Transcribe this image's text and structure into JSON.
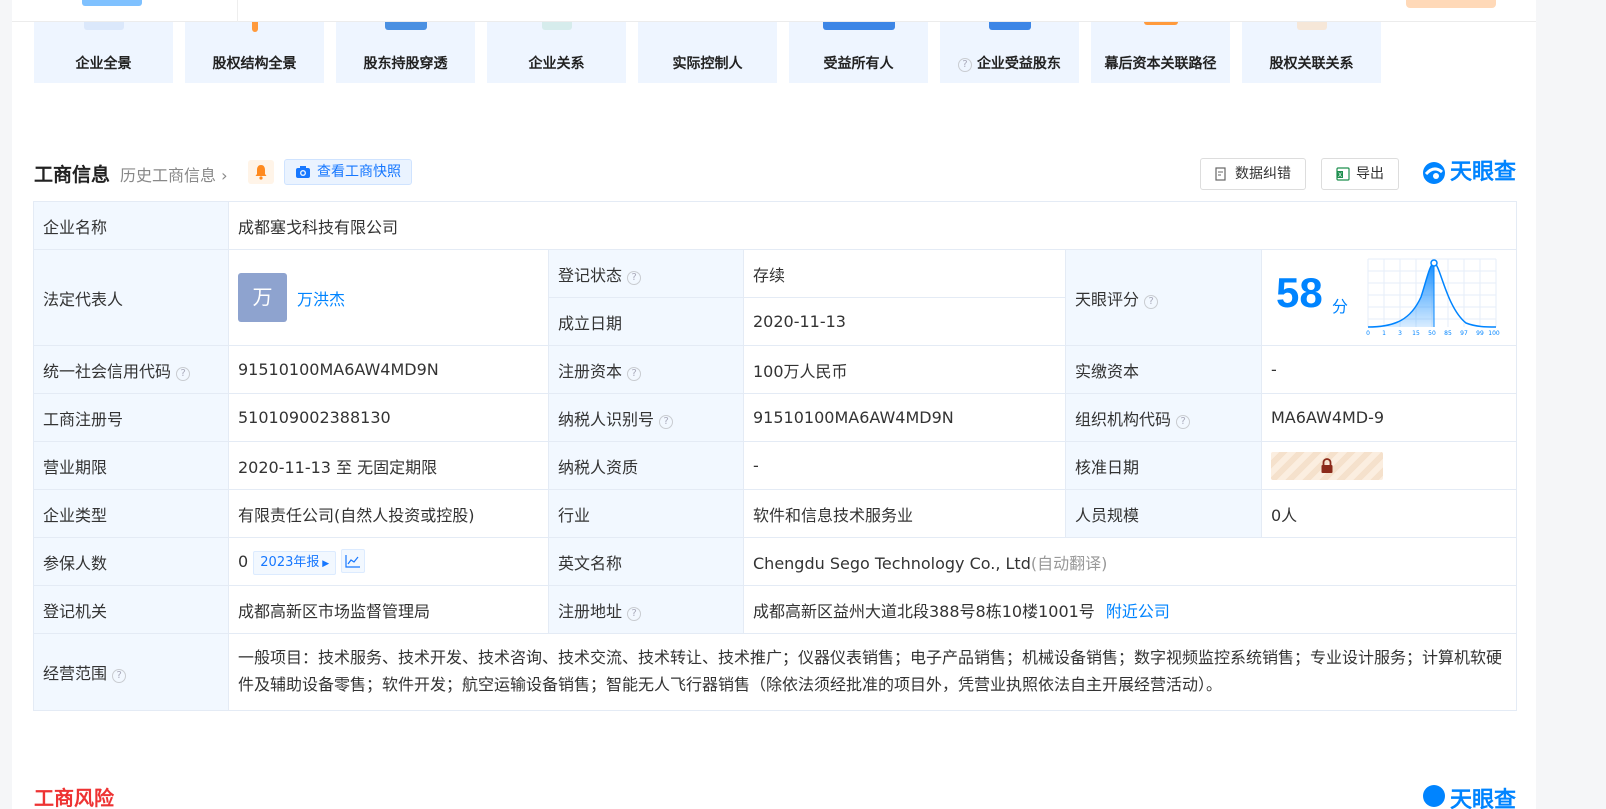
{
  "tiles": [
    {
      "label": "企业全景",
      "has_help": false
    },
    {
      "label": "股权结构全景",
      "has_help": false
    },
    {
      "label": "股东持股穿透",
      "has_help": false
    },
    {
      "label": "企业关系",
      "has_help": false
    },
    {
      "label": "实际控制人",
      "has_help": false
    },
    {
      "label": "受益所有人",
      "has_help": false
    },
    {
      "label": "企业受益股东",
      "has_help": true
    },
    {
      "label": "幕后资本关联路径",
      "has_help": false
    },
    {
      "label": "股权关联关系",
      "has_help": false
    }
  ],
  "section": {
    "title": "工商信息",
    "history": "历史工商信息",
    "snapshot": "查看工商快照",
    "correct": "数据纠错",
    "export": "导出",
    "brand": "天眼查"
  },
  "info": {
    "company_name_label": "企业名称",
    "company_name": "成都塞戈科技有限公司",
    "legal_rep_label": "法定代表人",
    "legal_rep_avatar": "万",
    "legal_rep": "万洪杰",
    "reg_status_label": "登记状态",
    "reg_status": "存续",
    "established_label": "成立日期",
    "established": "2020-11-13",
    "score_label": "天眼评分",
    "score": "58",
    "score_unit": "分",
    "score_ticks": [
      "0",
      "1",
      "3",
      "15",
      "50",
      "85",
      "97",
      "99",
      "100"
    ],
    "credit_code_label": "统一社会信用代码",
    "credit_code": "91510100MA6AW4MD9N",
    "reg_capital_label": "注册资本",
    "reg_capital": "100万人民币",
    "paid_capital_label": "实缴资本",
    "paid_capital": "-",
    "reg_no_label": "工商注册号",
    "reg_no": "510109002388130",
    "taxpayer_id_label": "纳税人识别号",
    "taxpayer_id": "91510100MA6AW4MD9N",
    "org_code_label": "组织机构代码",
    "org_code": "MA6AW4MD-9",
    "term_label": "营业期限",
    "term": "2020-11-13 至 无固定期限",
    "taxpayer_qual_label": "纳税人资质",
    "taxpayer_qual": "-",
    "approve_date_label": "核准日期",
    "type_label": "企业类型",
    "type": "有限责任公司(自然人投资或控股)",
    "industry_label": "行业",
    "industry": "软件和信息技术服务业",
    "staff_label": "人员规模",
    "staff": "0人",
    "insured_label": "参保人数",
    "insured": "0",
    "insured_report": "2023年报",
    "english_label": "英文名称",
    "english": "Chengdu Sego Technology Co., Ltd",
    "english_note": "(自动翻译)",
    "authority_label": "登记机关",
    "authority": "成都高新区市场监督管理局",
    "address_label": "注册地址",
    "address": "成都高新区益州大道北段388号8栋10楼1001号",
    "nearby": "附近公司",
    "scope_label": "经营范围",
    "scope": "一般项目：技术服务、技术开发、技术咨询、技术交流、技术转让、技术推广；仪器仪表销售；电子产品销售；机械设备销售；数字视频监控系统销售；专业设计服务；计算机软硬件及辅助设备零售；软件开发；航空运输设备销售；智能无人飞行器销售（除依法须经批准的项目外，凭营业执照依法自主开展经营活动）。"
  },
  "bottom": {
    "title": "工商风险",
    "brand": "天眼查"
  },
  "colors": {
    "accent": "#0084ff",
    "label_bg": "#f2f8ff",
    "status_green": "#17a34a"
  }
}
